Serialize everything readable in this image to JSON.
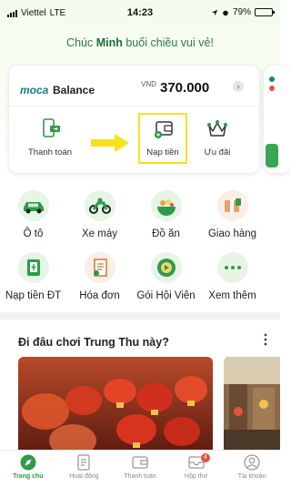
{
  "status_bar": {
    "carrier": "Viettel",
    "network": "LTE",
    "time": "14:23",
    "battery": "79%",
    "battery_level": 0.79
  },
  "greeting": {
    "prefix": "Chúc ",
    "name": "Minh",
    "suffix": " buổi chiều vui vẻ!"
  },
  "wallet": {
    "brand": "moca",
    "label": "Balance",
    "currency": "VND",
    "amount": "370.000",
    "actions": [
      {
        "label": "Thanh toán",
        "icon": "payment-phone-icon"
      },
      {
        "label": "Nạp tiền",
        "icon": "wallet-topup-icon"
      },
      {
        "label": "Ưu đãi",
        "icon": "crown-offer-icon"
      }
    ],
    "highlight_color": "#f4e21a",
    "arrow_color": "#f4e21a"
  },
  "services": [
    {
      "label": "Ô tô",
      "icon": "car-icon"
    },
    {
      "label": "Xe máy",
      "icon": "motorbike-icon"
    },
    {
      "label": "Đồ ăn",
      "icon": "food-icon"
    },
    {
      "label": "Giao hàng",
      "icon": "delivery-icon"
    },
    {
      "label": "Nạp tiền ĐT",
      "icon": "phone-topup-icon"
    },
    {
      "label": "Hóa đơn",
      "icon": "bill-icon"
    },
    {
      "label": "Gói Hội Viên",
      "icon": "membership-icon"
    },
    {
      "label": "Xem thêm",
      "icon": "more-icon"
    }
  ],
  "section": {
    "title": "Đi đâu chơi Trung Thu này?"
  },
  "tabs": [
    {
      "label": "Trang chủ",
      "icon": "home-compass-icon",
      "active": true
    },
    {
      "label": "Hoạt động",
      "icon": "activity-icon",
      "active": false
    },
    {
      "label": "Thanh toán",
      "icon": "payment-icon",
      "active": false
    },
    {
      "label": "Hộp thư",
      "icon": "inbox-icon",
      "active": false,
      "badge": "4"
    },
    {
      "label": "Tài khoản",
      "icon": "account-icon",
      "active": false
    }
  ],
  "colors": {
    "brand_green": "#00b14f",
    "active_tab": "#2e9a4a",
    "greeting_text": "#2e7d45"
  }
}
